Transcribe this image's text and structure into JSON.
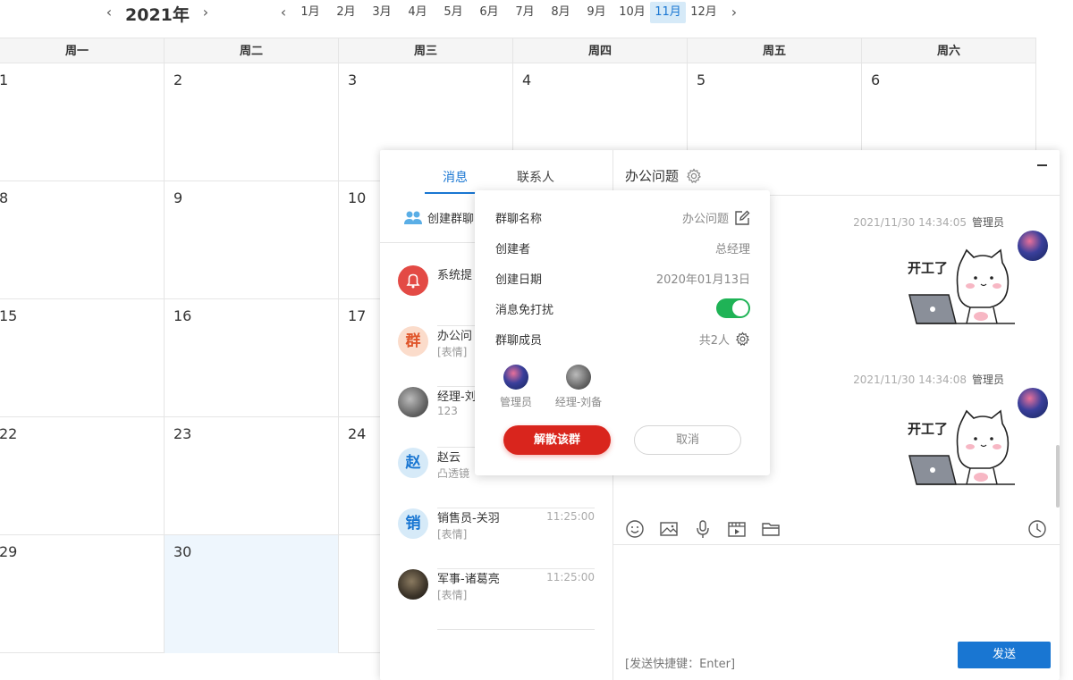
{
  "calendar": {
    "year": "2021年",
    "months": [
      "1月",
      "2月",
      "3月",
      "4月",
      "5月",
      "6月",
      "7月",
      "8月",
      "9月",
      "10月",
      "11月",
      "12月"
    ],
    "active_month_index": 10,
    "weekdays": [
      "周一",
      "周二",
      "周三",
      "周四",
      "周五",
      "周六"
    ],
    "weeks": [
      [
        "1",
        "2",
        "3",
        "4",
        "5",
        "6"
      ],
      [
        "8",
        "9",
        "10",
        "",
        "",
        ""
      ],
      [
        "15",
        "16",
        "17",
        "",
        "",
        ""
      ],
      [
        "22",
        "23",
        "24",
        "",
        "",
        ""
      ],
      [
        "29",
        "30",
        "",
        "",
        "",
        ""
      ]
    ],
    "today": "30"
  },
  "chat": {
    "tabs": [
      "消息",
      "联系人"
    ],
    "create_group": "创建群聊",
    "conversations": [
      {
        "avatar_text": "",
        "name": "系统提",
        "sub": "",
        "time": "",
        "avatar": "bell-icon"
      },
      {
        "avatar_text": "群",
        "name": "办公问",
        "sub": "[表情]",
        "time": ""
      },
      {
        "avatar_text": "",
        "name": "经理-刘",
        "sub": "123",
        "time": ""
      },
      {
        "avatar_text": "赵",
        "name": "赵云",
        "sub": "凸透镜",
        "time": ""
      },
      {
        "avatar_text": "销",
        "name": "销售员-关羽",
        "sub": "[表情]",
        "time": "11:25:00"
      },
      {
        "avatar_text": "",
        "name": "军事-诸葛亮",
        "sub": "[表情]",
        "time": "11:25:00"
      }
    ],
    "title": "办公问题",
    "messages": [
      {
        "time": "2021/11/30 14:34:05",
        "sender": "管理员",
        "sticker_text": "开工了"
      },
      {
        "time": "2021/11/30 14:34:08",
        "sender": "管理员",
        "sticker_text": "开工了"
      }
    ],
    "shortcut_hint": "[发送快捷键：Enter]",
    "send_label": "发送"
  },
  "popup": {
    "rows": [
      {
        "label": "群聊名称",
        "value": "办公问题"
      },
      {
        "label": "创建者",
        "value": "总经理"
      },
      {
        "label": "创建日期",
        "value": "2020年01月13日"
      },
      {
        "label": "消息免打扰",
        "value": ""
      },
      {
        "label": "群聊成员",
        "value": "共2人"
      }
    ],
    "mute_on": true,
    "members": [
      "管理员",
      "经理-刘备"
    ],
    "dissolve_label": "解散该群",
    "cancel_label": "取消"
  },
  "colors": {
    "accent": "#1976d2",
    "danger": "#d9251d",
    "toggle_on": "#1fb356"
  }
}
